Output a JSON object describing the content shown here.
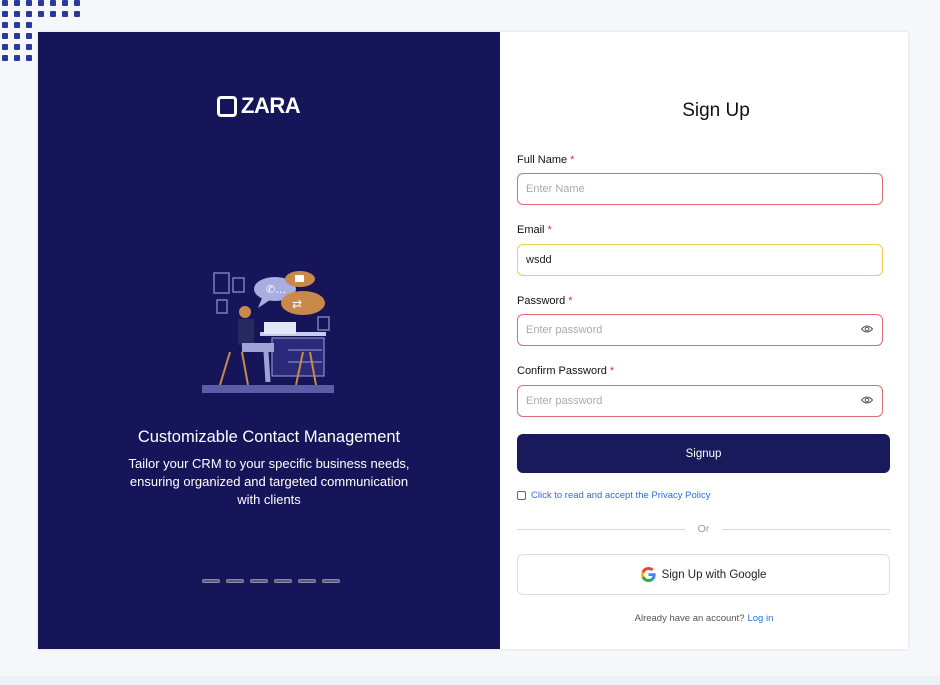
{
  "brand": {
    "name": "ZARA"
  },
  "feature": {
    "title": "Customizable Contact Management",
    "description": "Tailor your CRM to your specific business needs, ensuring organized and targeted communication with clients"
  },
  "carousel": {
    "slides": 6,
    "active": 0
  },
  "form": {
    "title": "Sign Up",
    "full_name": {
      "label": "Full Name",
      "required": "*",
      "value": "",
      "placeholder": "Enter Name"
    },
    "email": {
      "label": "Email",
      "required": "*",
      "value": "wsdd",
      "placeholder": ""
    },
    "password": {
      "label": "Password",
      "required": "*",
      "value": "",
      "placeholder": "Enter password"
    },
    "confirm_password": {
      "label": "Confirm Password",
      "required": "*",
      "value": "",
      "placeholder": "Enter password"
    },
    "submit_label": "Signup",
    "policy_label": "Click to read and accept the Privacy Policy",
    "divider_label": "Or",
    "google_label": "Sign Up with Google",
    "login_prompt": "Already have an account?",
    "login_link": "Log in"
  },
  "colors": {
    "panel": "#171559",
    "button": "#191a5c",
    "error_border": "#e06a76",
    "focus_border": "#eccf52",
    "link": "#2b6fd8"
  }
}
